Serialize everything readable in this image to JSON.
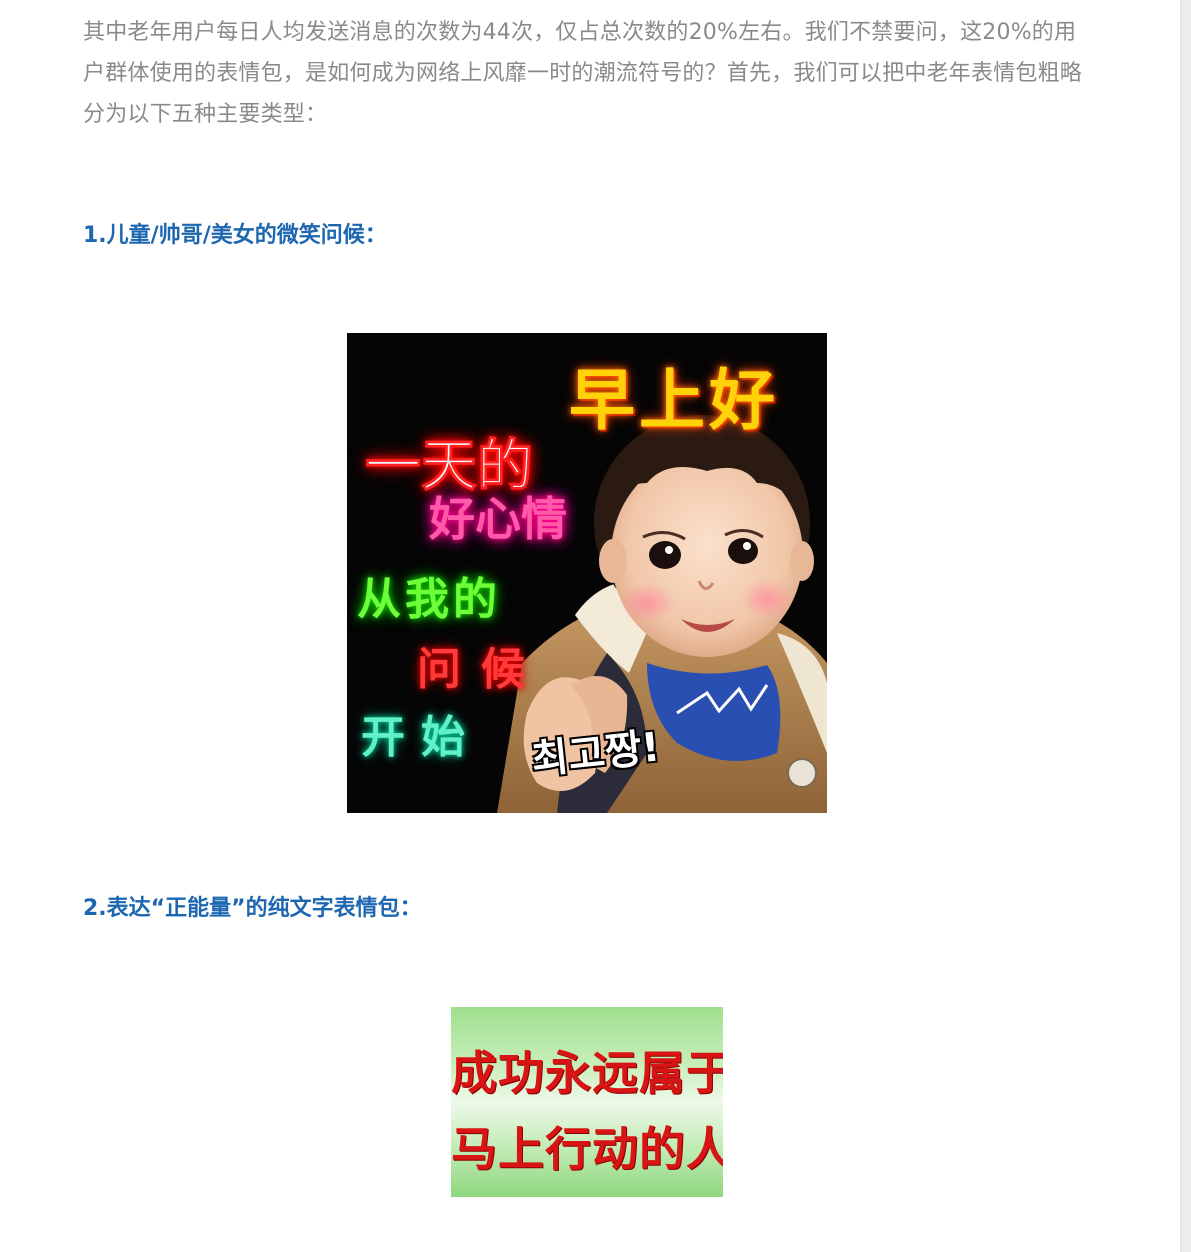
{
  "article": {
    "intro_paragraph": "其中老年用户每日人均发送消息的次数为44次，仅占总次数的20%左右。我们不禁要问，这20%的用户群体使用的表情包，是如何成为网络上风靡一时的潮流符号的？首先，我们可以把中老年表情包粗略分为以下五种主要类型：",
    "section1_heading": "1.儿童/帅哥/美女的微笑问候：",
    "section2_heading": "2.表达“正能量”的纯文字表情包："
  },
  "meme1": {
    "line_zao": "早上好",
    "line_yitian": "一天的",
    "line_haoxinqing": "好心情",
    "line_congwode": "从我的",
    "line_wenhou": "问候",
    "line_kaishi": "开始",
    "korean_text": "최고짱!"
  },
  "meme2": {
    "line1": "成功永远属于",
    "line2": "马上行动的人"
  },
  "colors": {
    "body_text": "#8a8a8a",
    "heading": "#1d67b0",
    "meme2_text": "#d81414",
    "meme2_bg": "#c7eeb8"
  }
}
